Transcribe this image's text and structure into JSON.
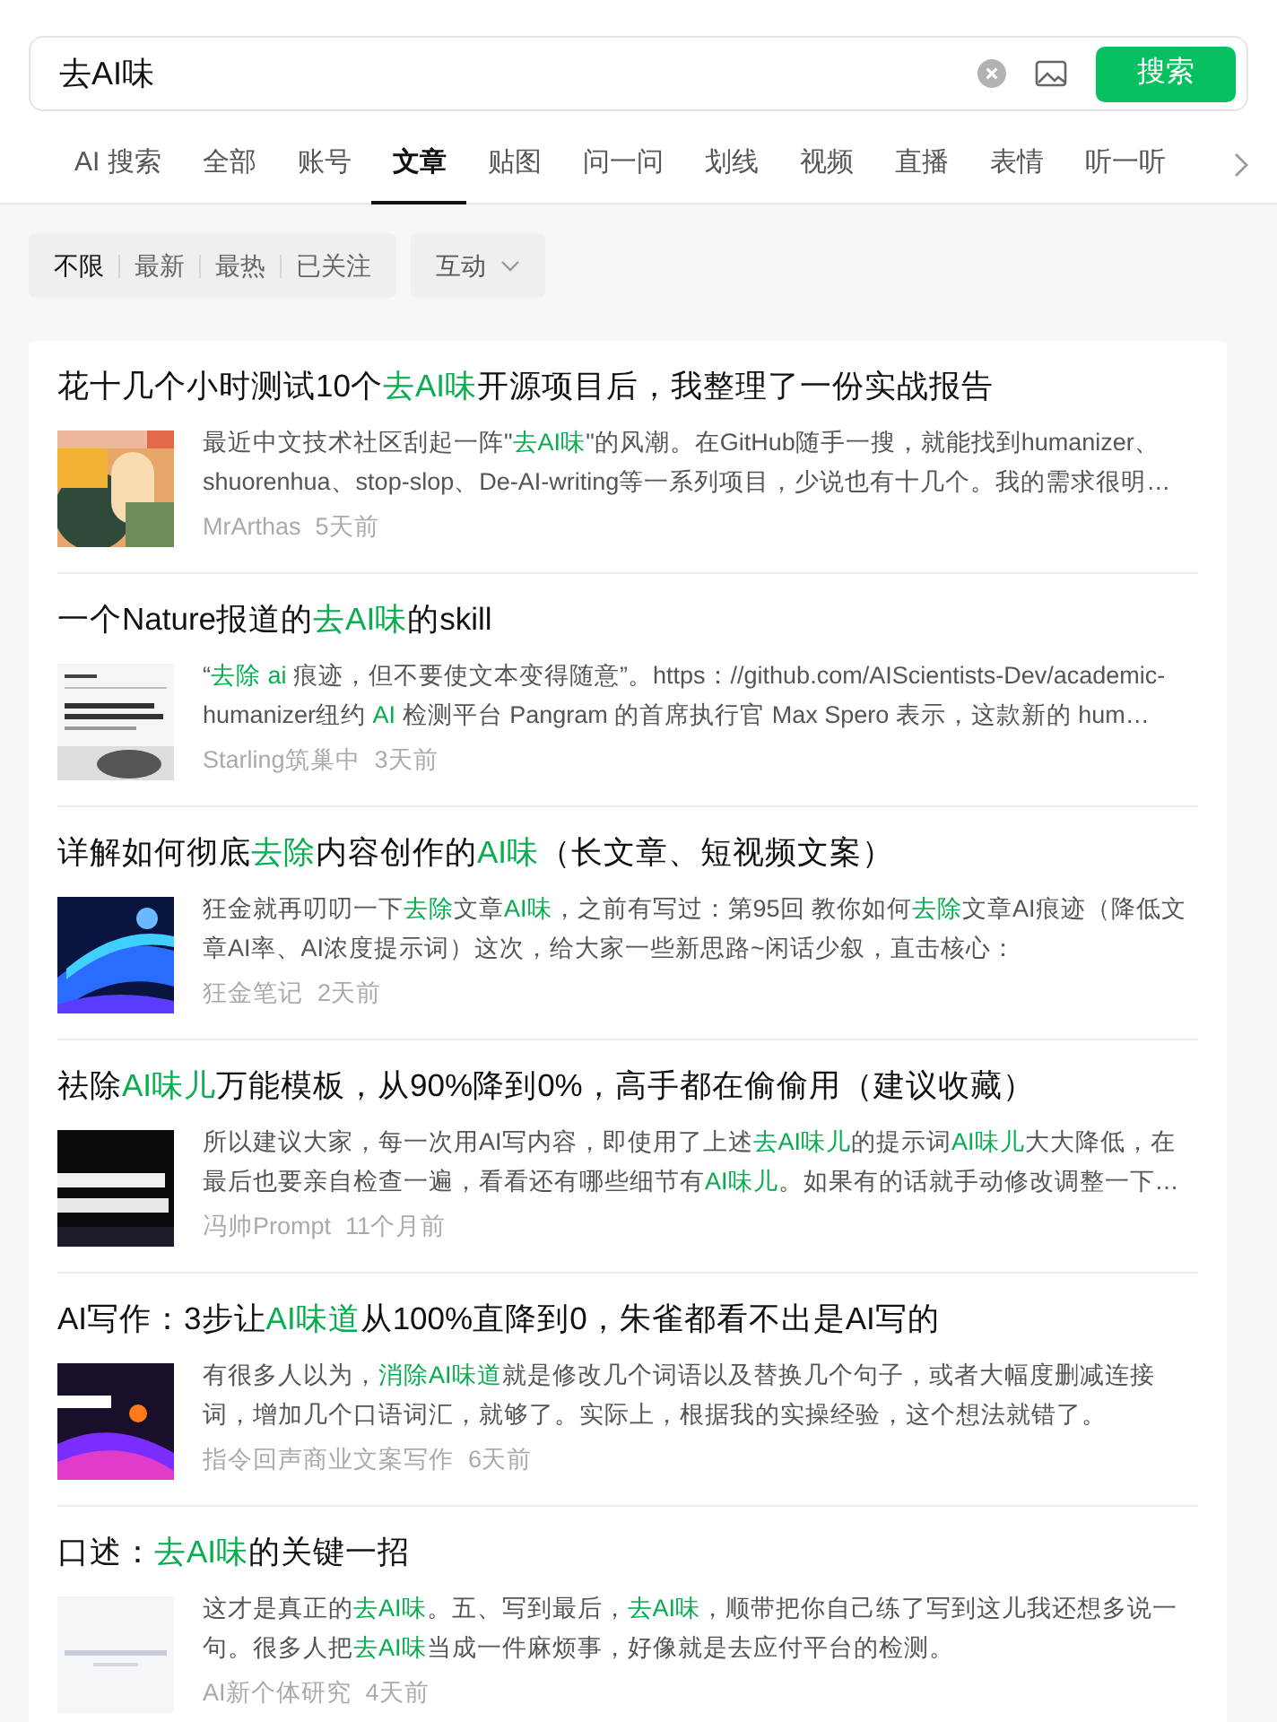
{
  "search": {
    "value": "去AI味",
    "button": "搜索"
  },
  "tabs": [
    {
      "label": "AI 搜索",
      "selected": false
    },
    {
      "label": "全部",
      "selected": false
    },
    {
      "label": "账号",
      "selected": false
    },
    {
      "label": "文章",
      "selected": true
    },
    {
      "label": "贴图",
      "selected": false
    },
    {
      "label": "问一问",
      "selected": false
    },
    {
      "label": "划线",
      "selected": false
    },
    {
      "label": "视频",
      "selected": false
    },
    {
      "label": "直播",
      "selected": false
    },
    {
      "label": "表情",
      "selected": false
    },
    {
      "label": "听一听",
      "selected": false
    }
  ],
  "filters": [
    {
      "label": "不限",
      "selected": true
    },
    {
      "label": "最新",
      "selected": false
    },
    {
      "label": "最热",
      "selected": false
    },
    {
      "label": "已关注",
      "selected": false
    }
  ],
  "dropdown": {
    "label": "互动"
  },
  "results": [
    {
      "title": [
        {
          "text": "花十几个小时测试10个",
          "highlight": false
        },
        {
          "text": "去AI味",
          "highlight": true
        },
        {
          "text": "开源项目后，我整理了一份实战报告",
          "highlight": false
        }
      ],
      "snippet": [
        {
          "text": "最近中文技术社区刮起一阵\"",
          "highlight": false
        },
        {
          "text": "去AI味",
          "highlight": true
        },
        {
          "text": "\"的风潮。在GitHub随手一搜，就能找到humanizer、shuorenhua、stop-slop、De-AI-writing等一系列项目，少说也有十几个。我的需求很明…",
          "highlight": false
        }
      ],
      "author": "MrArthas",
      "time": "5天前",
      "thumbnail": {
        "kind": "picture"
      }
    },
    {
      "title": [
        {
          "text": "一个Nature报道的",
          "highlight": false
        },
        {
          "text": "去AI味",
          "highlight": true
        },
        {
          "text": "的skill",
          "highlight": false
        }
      ],
      "snippet": [
        {
          "text": "“",
          "highlight": false
        },
        {
          "text": "去除 ai",
          "highlight": true
        },
        {
          "text": " 痕迹，但不要使文本变得随意”。https：//github.com/AIScientists-Dev/academic-humanizer纽约 ",
          "highlight": false
        },
        {
          "text": "AI",
          "highlight": true
        },
        {
          "text": " 检测平台 Pangram 的首席执行官 Max Spero 表示，这款新的 hum…",
          "highlight": false
        }
      ],
      "author": "Starling筑巢中",
      "time": "3天前",
      "thumbnail": {
        "kind": "picture"
      }
    },
    {
      "title": [
        {
          "text": "详解如何彻底",
          "highlight": false
        },
        {
          "text": "去除",
          "highlight": true
        },
        {
          "text": "内容创作的",
          "highlight": false
        },
        {
          "text": "AI味",
          "highlight": true
        },
        {
          "text": "（长文章、短视频文案）",
          "highlight": false
        }
      ],
      "snippet": [
        {
          "text": "狂金就再叨叨一下",
          "highlight": false
        },
        {
          "text": "去除",
          "highlight": true
        },
        {
          "text": "文章",
          "highlight": false
        },
        {
          "text": "AI味",
          "highlight": true
        },
        {
          "text": "，之前有写过：第95回 教你如何",
          "highlight": false
        },
        {
          "text": "去除",
          "highlight": true
        },
        {
          "text": "文章AI痕迹（降低文章AI率、AI浓度提示词）这次，给大家一些新思路~闲话少叙，直击核心：",
          "highlight": false
        }
      ],
      "author": "狂金笔记",
      "time": "2天前",
      "thumbnail": {
        "kind": "picture"
      }
    },
    {
      "title": [
        {
          "text": "祛除",
          "highlight": false
        },
        {
          "text": "AI味儿",
          "highlight": true
        },
        {
          "text": "万能模板，从90%降到0%，高手都在偷偷用（建议收藏）",
          "highlight": false
        }
      ],
      "snippet": [
        {
          "text": "所以建议大家，每一次用AI写内容，即使用了上述",
          "highlight": false
        },
        {
          "text": "去AI味儿",
          "highlight": true
        },
        {
          "text": "的提示词",
          "highlight": false
        },
        {
          "text": "AI味儿",
          "highlight": true
        },
        {
          "text": "大大降低，在最后也要亲自检查一遍，看看还有哪些细节有",
          "highlight": false
        },
        {
          "text": "AI味儿",
          "highlight": true
        },
        {
          "text": "。如果有的话就手动修改调整一下…",
          "highlight": false
        }
      ],
      "author": "冯帅Prompt",
      "time": "11个月前",
      "thumbnail": {
        "kind": "picture"
      }
    },
    {
      "title": [
        {
          "text": "AI写作：3步让",
          "highlight": false
        },
        {
          "text": "AI味道",
          "highlight": true
        },
        {
          "text": "从100%直降到0，朱雀都看不出是AI写的",
          "highlight": false
        }
      ],
      "snippet": [
        {
          "text": "有很多人以为，",
          "highlight": false
        },
        {
          "text": "消除AI味道",
          "highlight": true
        },
        {
          "text": "就是修改几个词语以及替换几个句子，或者大幅度删减连接词，增加几个口语词汇，就够了。实际上，根据我的实操经验，这个想法就错了。",
          "highlight": false
        }
      ],
      "author": "指令回声商业文案写作",
      "time": "6天前",
      "thumbnail": {
        "kind": "picture"
      }
    },
    {
      "title": [
        {
          "text": "口述：",
          "highlight": false
        },
        {
          "text": "去AI味",
          "highlight": true
        },
        {
          "text": "的关键一招",
          "highlight": false
        }
      ],
      "snippet": [
        {
          "text": "这才是真正的",
          "highlight": false
        },
        {
          "text": "去AI味",
          "highlight": true
        },
        {
          "text": "。五、写到最后，",
          "highlight": false
        },
        {
          "text": "去AI味",
          "highlight": true
        },
        {
          "text": "，顺带把你自己练了写到这儿我还想多说一句。很多人把",
          "highlight": false
        },
        {
          "text": "去AI味",
          "highlight": true
        },
        {
          "text": "当成一件麻烦事，好像就是去应付平台的检测。",
          "highlight": false
        }
      ],
      "author": "AI新个体研究",
      "time": "4天前",
      "thumbnail": {
        "kind": "picture"
      }
    }
  ]
}
